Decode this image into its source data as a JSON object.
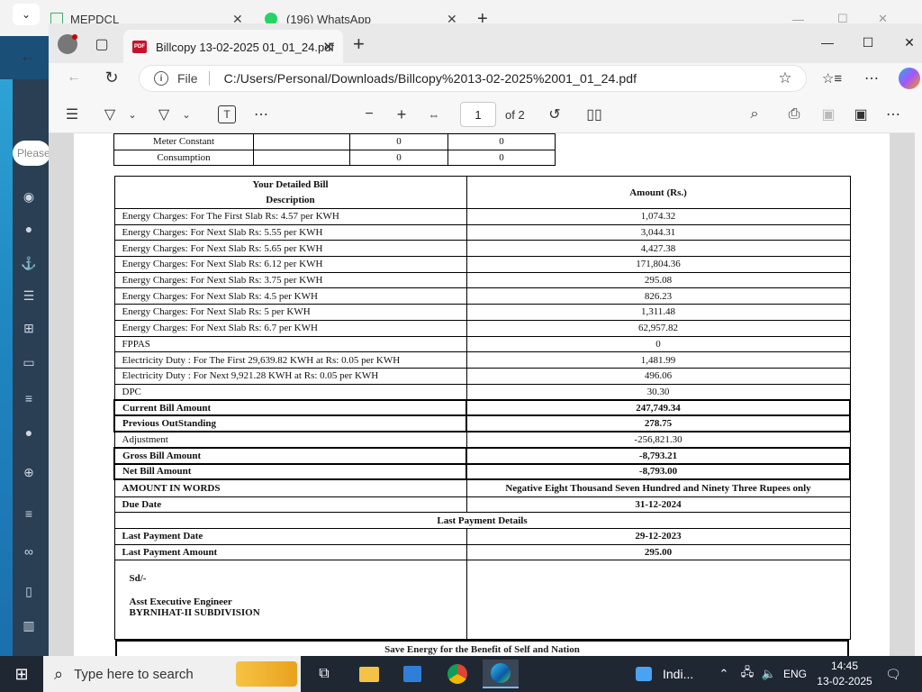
{
  "background_window": {
    "tabs": [
      {
        "title": "MEPDCL"
      },
      {
        "title": "(196) WhatsApp"
      }
    ]
  },
  "web_app": {
    "search_placeholder": "Please"
  },
  "browser": {
    "tab_title": "Billcopy 13-02-2025 01_01_24.pdf",
    "address_scheme_label": "File",
    "address_url": "C:/Users/Personal/Downloads/Billcopy%2013-02-2025%2001_01_24.pdf"
  },
  "pdf_toolbar": {
    "current_page": "1",
    "page_count_label": "of 2"
  },
  "bill": {
    "meter_rows": [
      {
        "label": "Meter Constant",
        "val1": "0",
        "val2": "0"
      },
      {
        "label": "Consumption",
        "val1": "0",
        "val2": "0"
      }
    ],
    "heading": "Your Detailed Bill",
    "description_header": "Description",
    "amount_header": "Amount (Rs.)",
    "charges": [
      {
        "desc": "Energy Charges: For The First Slab Rs: 4.57 per KWH",
        "amount": "1,074.32"
      },
      {
        "desc": "Energy Charges: For Next Slab Rs: 5.55 per KWH",
        "amount": "3,044.31"
      },
      {
        "desc": "Energy Charges: For Next Slab Rs: 5.65 per KWH",
        "amount": "4,427.38"
      },
      {
        "desc": "Energy Charges: For Next Slab Rs: 6.12 per KWH",
        "amount": "171,804.36"
      },
      {
        "desc": "Energy Charges: For Next Slab Rs: 3.75 per KWH",
        "amount": "295.08"
      },
      {
        "desc": "Energy Charges: For Next Slab Rs: 4.5 per KWH",
        "amount": "826.23"
      },
      {
        "desc": "Energy Charges: For Next Slab Rs: 5 per KWH",
        "amount": "1,311.48"
      },
      {
        "desc": "Energy Charges: For Next Slab Rs: 6.7 per KWH",
        "amount": "62,957.82"
      },
      {
        "desc": "FPPAS",
        "amount": "0"
      },
      {
        "desc": "Electricity Duty : For The First 29,639.82 KWH at Rs: 0.05 per KWH",
        "amount": "1,481.99"
      },
      {
        "desc": "Electricity Duty : For Next 9,921.28 KWH at Rs: 0.05 per KWH",
        "amount": "496.06"
      },
      {
        "desc": "DPC",
        "amount": "30.30"
      }
    ],
    "current_bill_label": "Current Bill Amount",
    "current_bill_amount": "247,749.34",
    "previous_outstanding_label": "Previous OutStanding",
    "previous_outstanding_amount": "278.75",
    "adjustment_label": "Adjustment",
    "adjustment_amount": "-256,821.30",
    "gross_bill_label": "Gross Bill Amount",
    "gross_bill_amount": "-8,793.21",
    "net_bill_label": "Net Bill Amount",
    "net_bill_amount": "-8,793.00",
    "amount_in_words_label": "AMOUNT IN WORDS",
    "amount_in_words": "Negative Eight Thousand Seven Hundred and Ninety Three Rupees only",
    "due_date_label": "Due Date",
    "due_date": "31-12-2024",
    "last_payment_heading": "Last Payment Details",
    "last_payment_date_label": "Last Payment Date",
    "last_payment_date": "29-12-2023",
    "last_payment_amount_label": "Last Payment Amount",
    "last_payment_amount": "295.00",
    "signature": "Sd/-",
    "signatory_title": "Asst Executive Engineer",
    "signatory_office": "BYRNIHAT-II SUBDIVISION",
    "footer_slogan": "Save Energy for the Benefit of Self and Nation"
  },
  "taskbar": {
    "search_placeholder": "Type here to search",
    "widget_label": "Indi...",
    "language": "ENG",
    "time": "14:45",
    "date": "13-02-2025"
  },
  "colors": {
    "taskbar": "#1f2733",
    "pdf_icon": "#c8102e",
    "sidebar": "#2a3f54"
  }
}
